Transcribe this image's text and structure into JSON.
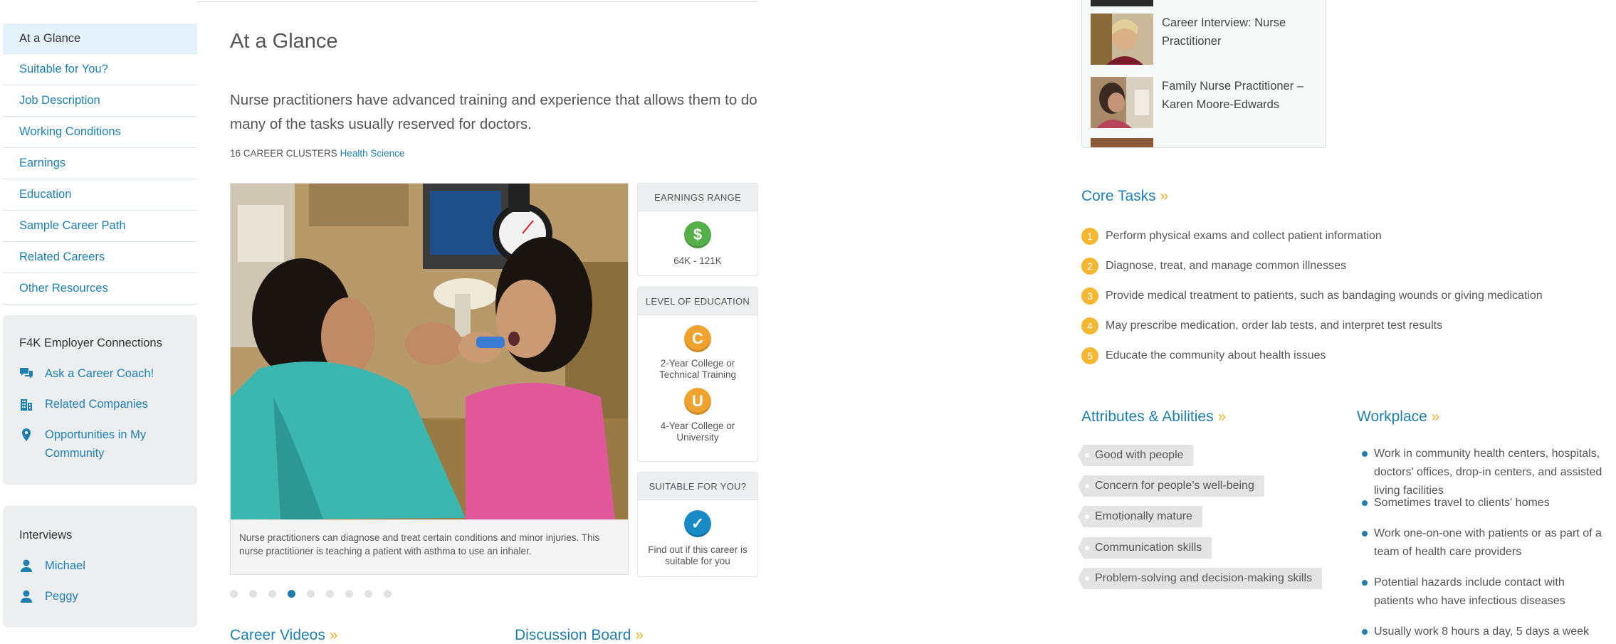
{
  "sidebar": {
    "items": [
      {
        "label": "At a Glance",
        "active": true
      },
      {
        "label": "Suitable for You?"
      },
      {
        "label": "Job Description"
      },
      {
        "label": "Working Conditions"
      },
      {
        "label": "Earnings"
      },
      {
        "label": "Education"
      },
      {
        "label": "Sample Career Path"
      },
      {
        "label": "Related Careers"
      },
      {
        "label": "Other Resources"
      }
    ],
    "employer": {
      "title": "F4K Employer Connections",
      "links": [
        {
          "label": "Ask a Career Coach!",
          "icon": "chat-icon"
        },
        {
          "label": "Related Companies",
          "icon": "building-icon"
        },
        {
          "label": "Opportunities in My Community",
          "icon": "map-pin-icon"
        }
      ]
    },
    "interviews": {
      "title": "Interviews",
      "links": [
        {
          "label": "Michael",
          "icon": "person-icon"
        },
        {
          "label": "Peggy",
          "icon": "person-icon"
        }
      ]
    }
  },
  "main": {
    "title": "At a Glance",
    "intro": "Nurse practitioners have advanced training and experience that allows them to do many of the tasks usually reserved for doctors.",
    "clusters_label": "16 CAREER CLUSTERS",
    "clusters_link": "Health Science",
    "photo_caption": "Nurse practitioners can diagnose and treat certain conditions and minor injuries. This nurse practitioner is teaching a patient with asthma to use an inhaler.",
    "carousel": {
      "total": 9,
      "active": 4
    },
    "earnings": {
      "heading": "EARNINGS RANGE",
      "badge": "$",
      "value": "64K - 121K",
      "color": "#4caf50"
    },
    "education": {
      "heading": "LEVEL OF EDUCATION",
      "levels": [
        {
          "badge": "C",
          "label": "2-Year College or Technical Training",
          "color": "#f0a22e"
        },
        {
          "badge": "U",
          "label": "4-Year College or University",
          "color": "#f0a22e"
        }
      ]
    },
    "suitable": {
      "heading": "SUITABLE FOR YOU?",
      "badge": "✓",
      "text": "Find out if this career is suitable for you",
      "color": "#1a8ac6"
    },
    "career_videos": "Career Videos",
    "discussion_board": "Discussion Board",
    "raquo": "»"
  },
  "videos": [
    {
      "title": "Career Interview: Nurse Practitioner"
    },
    {
      "title": "Family Nurse Practitioner – Karen Moore-Edwards"
    }
  ],
  "core_tasks": {
    "title": "Core Tasks",
    "items": [
      {
        "num": "1",
        "text": "Perform physical exams and collect patient information"
      },
      {
        "num": "2",
        "text": "Diagnose, treat, and manage common illnesses"
      },
      {
        "num": "3",
        "text": "Provide medical treatment to patients, such as bandaging wounds or giving medication"
      },
      {
        "num": "4",
        "text": "May prescribe medication, order lab tests, and interpret test results"
      },
      {
        "num": "5",
        "text": "Educate the community about health issues"
      }
    ]
  },
  "attributes": {
    "title": "Attributes & Abilities",
    "items": [
      "Good with people",
      "Concern for people’s well-being",
      "Emotionally mature",
      "Communication skills",
      "Problem-solving and decision-making skills"
    ]
  },
  "workplace": {
    "title": "Workplace",
    "items": [
      "Work in community health centers, hospitals, doctors' offices, drop-in centers, and assisted living facilities",
      "Sometimes travel to clients' homes",
      "Work one-on-one with patients or as part of a team of health care providers",
      "Potential hazards include contact with patients who have infectious diseases",
      "Usually work 8 hours a day, 5 days a week"
    ]
  }
}
